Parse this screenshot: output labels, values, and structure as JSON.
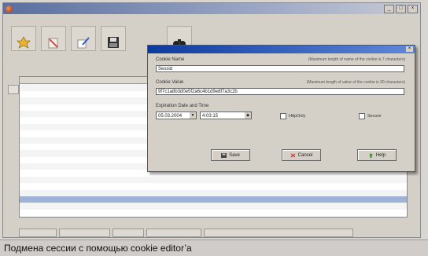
{
  "dialog": {
    "cookie_name_label": "Cookie Name",
    "cookie_name_hint": "(Maximum length of name of the cookie is 7 characters)",
    "cookie_name_value": "Sessid",
    "cookie_value_label": "Cookie Value",
    "cookie_value_hint": "(Maximum length of value of the cookie is 30 characters)",
    "cookie_value_value": "9f7c1a8b3d0e5f2a6c4b1d9e8f7a3c2b",
    "expiration_label": "Expiration Date and Time",
    "date_value": "05.03.2004",
    "time_value": "4:03:15",
    "httponly_label": "HttpOnly",
    "secure_label": "Secure",
    "save_label": "Save",
    "cancel_label": "Cancel",
    "help_label": "Help"
  },
  "caption": {
    "text": "Подмена сессии с помощью cookie editor’a"
  },
  "colors": {
    "dialog_title": "#0b3b9e",
    "selected_row": "#9fb3d6",
    "window_title": "#5a6fa0"
  }
}
